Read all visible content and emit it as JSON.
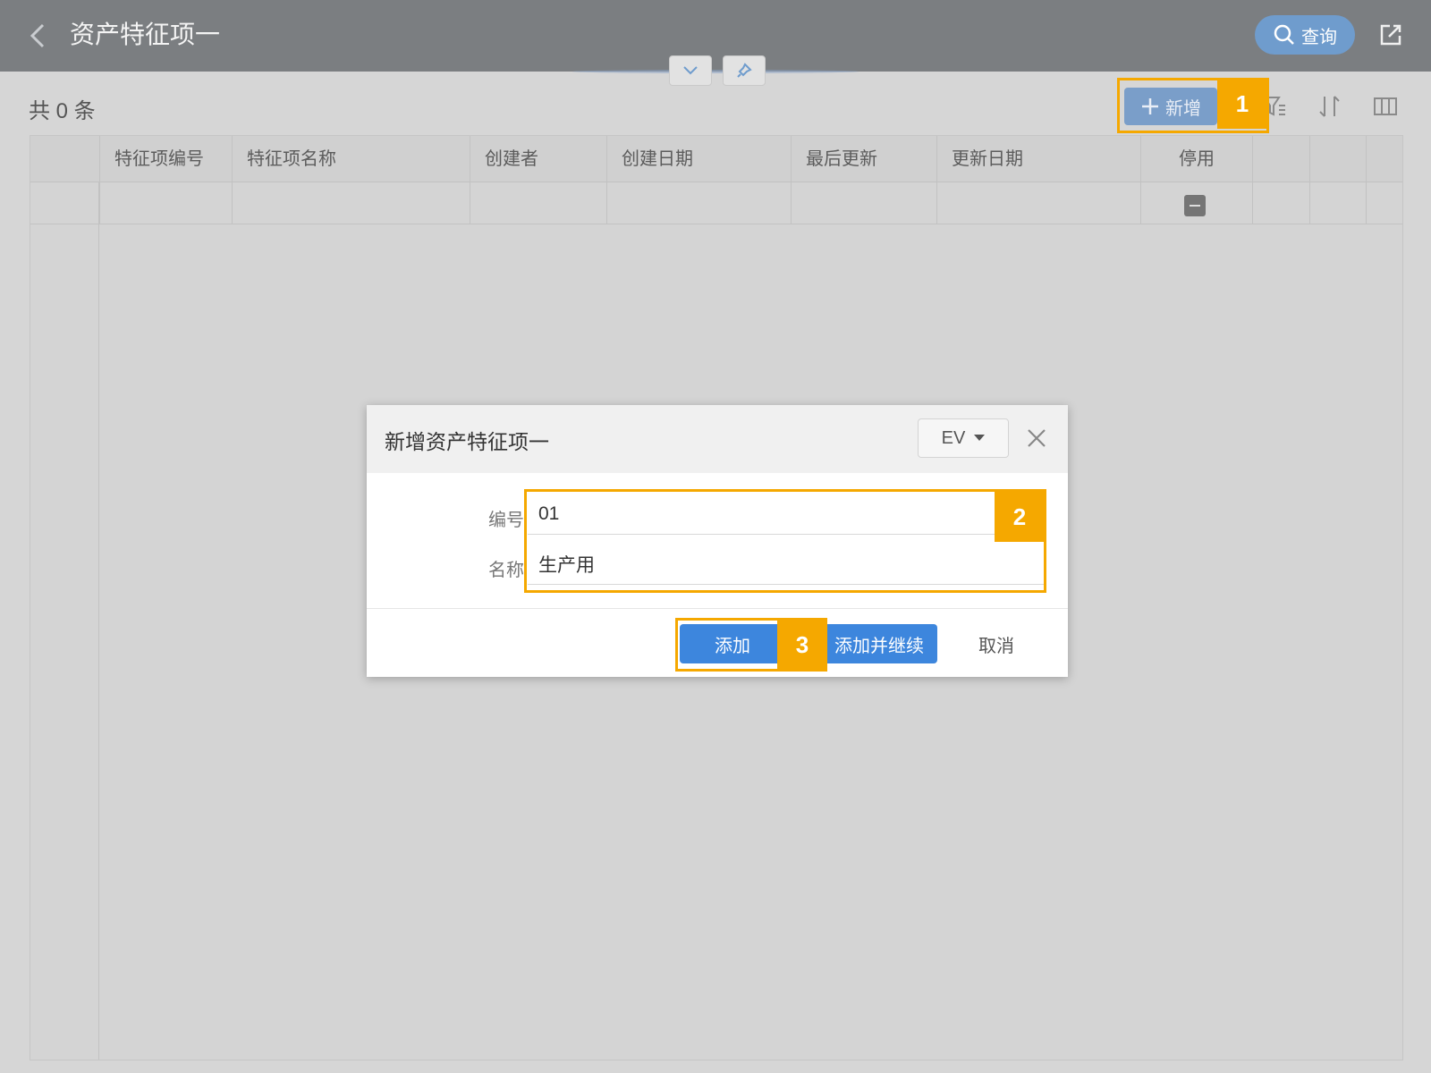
{
  "header": {
    "title": "资产特征项一",
    "query_label": "查询"
  },
  "toolbar": {
    "count_text": "共 0 条",
    "add_label": "新增"
  },
  "table": {
    "columns": [
      "特征项编号",
      "特征项名称",
      "创建者",
      "创建日期",
      "最后更新",
      "更新日期",
      "停用"
    ]
  },
  "modal": {
    "title": "新增资产特征项一",
    "language": "EV",
    "fields": [
      {
        "label": "编号",
        "value": "01"
      },
      {
        "label": "名称",
        "value": "生产用"
      }
    ],
    "add_label": "添加",
    "add_continue_label": "添加并继续",
    "cancel_label": "取消"
  },
  "callouts": [
    "1",
    "2",
    "3"
  ],
  "colors": {
    "header_bg": "#7b7e81",
    "primary": "#3d86dd",
    "highlight": "#f5a800"
  }
}
